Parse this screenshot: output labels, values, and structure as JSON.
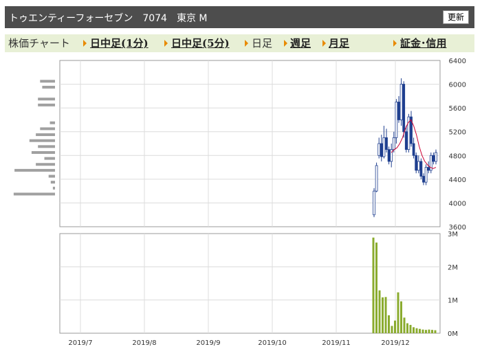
{
  "header": {
    "title": "トゥエンティーフォーセブン　7074　東京 M",
    "refresh_label": "更新"
  },
  "menu": {
    "chart_label": "株価チャート",
    "intraday_1": "日中足(1分)",
    "intraday_5": "日中足(5分)",
    "daily": "日足",
    "weekly": "週足",
    "monthly": "月足",
    "margin": "証金･信用"
  },
  "colors": {
    "up_candle": "#ffffff",
    "down_candle": "#1f3f8f",
    "moving_average": "#cc0033",
    "volume_bar": "#8aab2e",
    "volume_profile": "#a0a0a0"
  },
  "chart_data": [
    {
      "type": "candlestick",
      "ylim": [
        3600,
        6400
      ],
      "y_ticks": [
        "6400",
        "6000",
        "5600",
        "5200",
        "4800",
        "4400",
        "4000",
        "3600"
      ],
      "x_ticks": [
        "2019/7",
        "2019/8",
        "2019/9",
        "2019/10",
        "2019/11",
        "2019/12"
      ],
      "legend": "none",
      "grid": true,
      "candles": [
        [
          3800,
          4200,
          3760,
          4250
        ],
        [
          4200,
          4630,
          4180,
          4680
        ],
        [
          4800,
          5000,
          4750,
          5100
        ],
        [
          5000,
          4780,
          4700,
          5150
        ],
        [
          4780,
          5100,
          4750,
          5300
        ],
        [
          5100,
          4900,
          4850,
          5250
        ],
        [
          4900,
          4700,
          4650,
          4950
        ],
        [
          4700,
          4900,
          4600,
          5000
        ],
        [
          4900,
          5100,
          4850,
          5200
        ],
        [
          5100,
          5700,
          5000,
          5750
        ],
        [
          5700,
          5400,
          5350,
          5800
        ],
        [
          5400,
          6000,
          5300,
          6100
        ],
        [
          6000,
          5200,
          5100,
          6050
        ],
        [
          5200,
          4900,
          4850,
          5300
        ],
        [
          4900,
          5450,
          4850,
          5500
        ],
        [
          5450,
          5000,
          4950,
          5550
        ],
        [
          5000,
          4800,
          4750,
          5100
        ],
        [
          4800,
          4550,
          4500,
          4850
        ],
        [
          4550,
          4700,
          4500,
          4800
        ],
        [
          4700,
          4450,
          4400,
          4750
        ],
        [
          4450,
          4350,
          4300,
          4500
        ],
        [
          4350,
          4600,
          4300,
          4650
        ],
        [
          4600,
          4550,
          4500,
          4700
        ],
        [
          4550,
          4800,
          4500,
          4850
        ],
        [
          4800,
          4700,
          4650,
          4850
        ],
        [
          4700,
          4850,
          4650,
          4900
        ]
      ],
      "moving_average": [
        4850,
        4900,
        4930,
        5000,
        5100,
        5250,
        5350,
        5400,
        5300,
        5150,
        4950,
        4800,
        4700,
        4640,
        4600,
        4580,
        4600
      ],
      "volume_profile": [
        {
          "price": 6050,
          "value": 0.35
        },
        {
          "price": 5950,
          "value": 0.3
        },
        {
          "price": 5750,
          "value": 0.4
        },
        {
          "price": 5650,
          "value": 0.4
        },
        {
          "price": 5350,
          "value": 0.12
        },
        {
          "price": 5250,
          "value": 0.35
        },
        {
          "price": 5150,
          "value": 0.45
        },
        {
          "price": 5050,
          "value": 0.6
        },
        {
          "price": 4950,
          "value": 0.4
        },
        {
          "price": 4850,
          "value": 0.55
        },
        {
          "price": 4750,
          "value": 0.25
        },
        {
          "price": 4650,
          "value": 0.45
        },
        {
          "price": 4550,
          "value": 0.95
        },
        {
          "price": 4450,
          "value": 0.15
        },
        {
          "price": 4350,
          "value": 0.1
        },
        {
          "price": 4250,
          "value": 0.05
        },
        {
          "price": 4150,
          "value": 0.97
        }
      ]
    },
    {
      "type": "bar",
      "ylim": [
        0,
        3000000
      ],
      "y_ticks": [
        "3M",
        "2M",
        "1M",
        "0M"
      ],
      "grid": true,
      "legend": "none",
      "values": [
        2880000,
        2730000,
        1290000,
        1080000,
        1090000,
        540000,
        220000,
        380000,
        1230000,
        960000,
        470000,
        300000,
        250000,
        180000,
        150000,
        130000,
        110000,
        100000,
        110000,
        100000,
        90000
      ]
    }
  ]
}
